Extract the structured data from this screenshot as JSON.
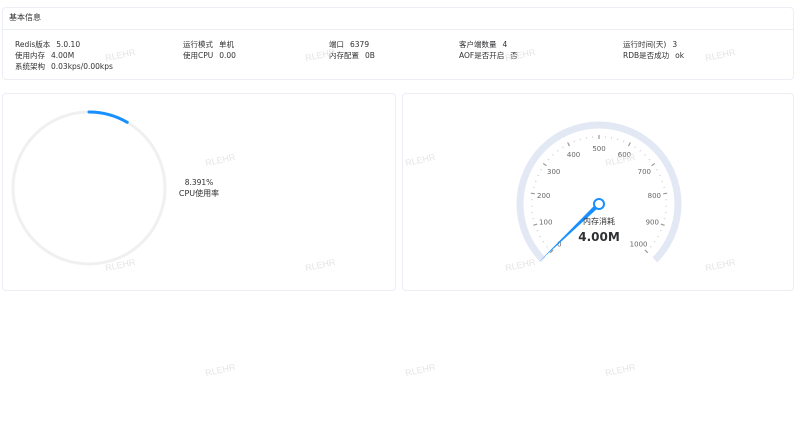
{
  "basic_info": {
    "title": "基本信息",
    "items": [
      {
        "label": "Redis版本",
        "value": "5.0.10"
      },
      {
        "label": "运行模式",
        "value": "单机"
      },
      {
        "label": "端口",
        "value": "6379"
      },
      {
        "label": "客户端数量",
        "value": "4"
      },
      {
        "label": "运行时间(天)",
        "value": "3"
      },
      {
        "label": "使用内存",
        "value": "4.00M"
      },
      {
        "label": "使用CPU",
        "value": "0.00"
      },
      {
        "label": "内存配置",
        "value": "0B"
      },
      {
        "label": "AOF是否开启",
        "value": "否"
      },
      {
        "label": "RDB是否成功",
        "value": "ok"
      },
      {
        "label": "系统架构",
        "value": "0.03kps/0.00kps"
      }
    ]
  },
  "cpu_gauge": {
    "percent_text": "8.391%",
    "label": "CPU使用率",
    "value_fraction": 0.08391,
    "progress_color": "#1890ff",
    "track_color": "#f0f0f0"
  },
  "memory_gauge": {
    "title": "内存消耗",
    "value_text": "4.00M",
    "min": 0,
    "max": 1000,
    "value": 4,
    "tick_labels": [
      "0",
      "100",
      "200",
      "300",
      "400",
      "500",
      "600",
      "700",
      "800",
      "900",
      "1000"
    ],
    "axis_color": "#e3e8f5",
    "pointer_color": "#1890ff"
  },
  "watermark": {
    "text": "RLEHR"
  }
}
